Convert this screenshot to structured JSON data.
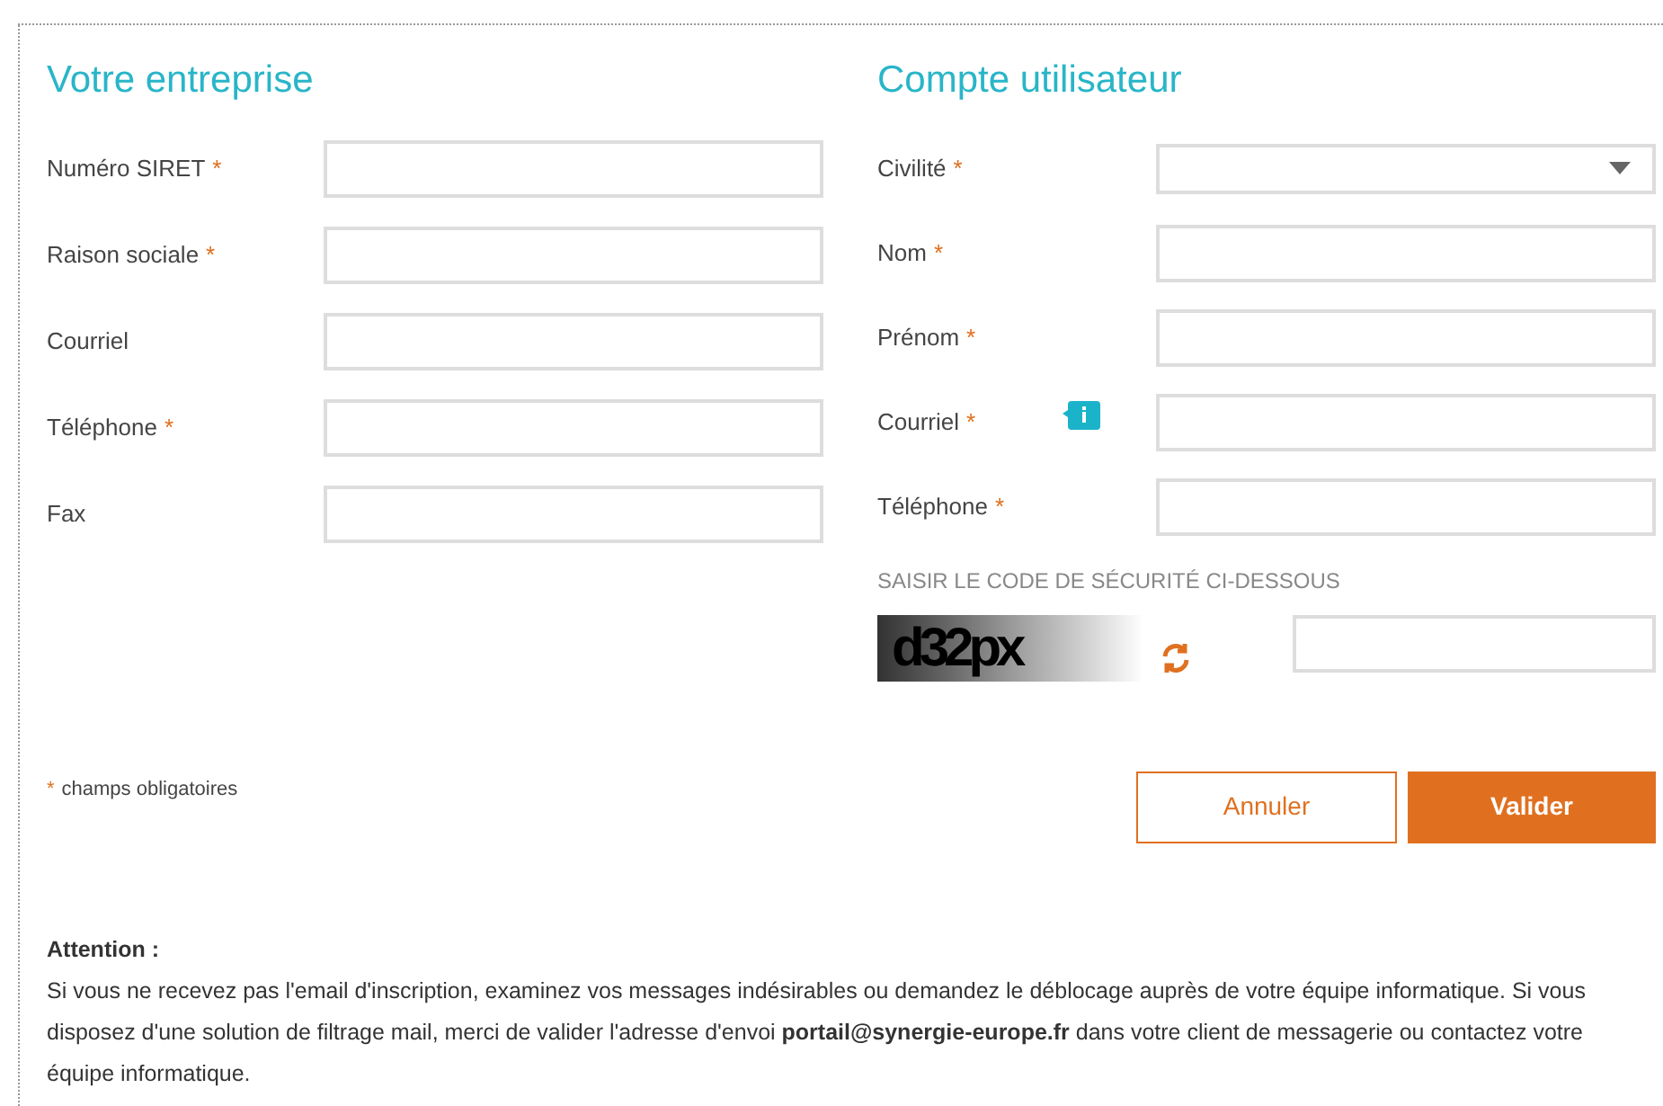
{
  "company": {
    "title": "Votre entreprise",
    "fields": [
      {
        "label": "Numéro SIRET",
        "mark": "*",
        "kind": "text"
      },
      {
        "label": "Raison sociale",
        "mark": "*",
        "kind": "text"
      },
      {
        "label": "Courriel",
        "kind": "text"
      },
      {
        "label": "Téléphone",
        "mark": "*",
        "kind": "text"
      },
      {
        "label": "Fax",
        "kind": "text"
      }
    ]
  },
  "account": {
    "title": "Compte utilisateur",
    "fields": [
      {
        "label": "Civilité",
        "mark": "*",
        "kind": "select"
      },
      {
        "label": "Nom",
        "mark": "*",
        "kind": "text"
      },
      {
        "label": "Prénom",
        "mark": "*",
        "kind": "text"
      },
      {
        "label": "Courriel",
        "mark": "*",
        "kind": "text",
        "info": true
      },
      {
        "label": "Téléphone",
        "mark": "*",
        "kind": "text"
      }
    ],
    "captcha": {
      "label": "SAISIR LE CODE DE SÉCURITÉ CI-DESSOUS",
      "code": "d32px"
    }
  },
  "required_note": {
    "mark": "*",
    "text": "champs obligatoires"
  },
  "buttons": [
    {
      "label": "Annuler",
      "kind": "secondary"
    },
    {
      "label": "Valider",
      "kind": "primary"
    }
  ],
  "notice": {
    "title": "Attention :",
    "text": "Si vous ne recevez pas l'email d'inscription, examinez vos messages indésirables ou demandez le déblocage auprès de votre équipe informatique. Si vous disposez d'une solution de filtrage mail, merci de valider l'adresse d'envoi **portail@synergie-europe.fr** dans votre client de messagerie ou contactez votre équipe informatique."
  }
}
